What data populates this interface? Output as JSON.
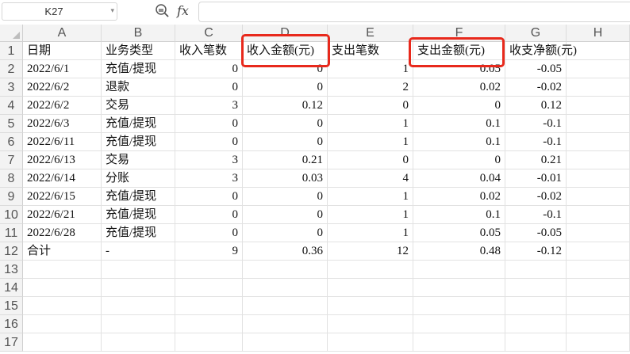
{
  "formula_bar": {
    "name_box": "K27",
    "fx_label": "fx",
    "formula": ""
  },
  "columns": [
    "A",
    "B",
    "C",
    "D",
    "E",
    "F",
    "G",
    "H"
  ],
  "row_numbers": [
    "1",
    "2",
    "3",
    "4",
    "5",
    "6",
    "7",
    "8",
    "9",
    "10",
    "11",
    "12",
    "13",
    "14",
    "15",
    "16",
    "17"
  ],
  "sheet": {
    "headers": [
      "日期",
      "业务类型",
      "收入笔数",
      "收入金额(元)",
      "支出笔数",
      "支出金额(元)",
      "收支净额(元)"
    ],
    "rows": [
      [
        "2022/6/1",
        "充值/提现",
        "0",
        "0",
        "1",
        "0.05",
        "-0.05"
      ],
      [
        "2022/6/2",
        "退款",
        "0",
        "0",
        "2",
        "0.02",
        "-0.02"
      ],
      [
        "2022/6/2",
        "交易",
        "3",
        "0.12",
        "0",
        "0",
        "0.12"
      ],
      [
        "2022/6/3",
        "充值/提现",
        "0",
        "0",
        "1",
        "0.1",
        "-0.1"
      ],
      [
        "2022/6/11",
        "充值/提现",
        "0",
        "0",
        "1",
        "0.1",
        "-0.1"
      ],
      [
        "2022/6/13",
        "交易",
        "3",
        "0.21",
        "0",
        "0",
        "0.21"
      ],
      [
        "2022/6/14",
        "分账",
        "3",
        "0.03",
        "4",
        "0.04",
        "-0.01"
      ],
      [
        "2022/6/15",
        "充值/提现",
        "0",
        "0",
        "1",
        "0.02",
        "-0.02"
      ],
      [
        "2022/6/21",
        "充值/提现",
        "0",
        "0",
        "1",
        "0.1",
        "-0.1"
      ],
      [
        "2022/6/28",
        "充值/提现",
        "0",
        "0",
        "1",
        "0.05",
        "-0.05"
      ]
    ],
    "total": [
      "合计",
      "-",
      "9",
      "0.36",
      "12",
      "0.48",
      "-0.12"
    ]
  },
  "highlight_color": "#e8291c",
  "icons": [
    "zoom-formula-icon",
    "dropdown-arrow-icon",
    "select-all-icon"
  ]
}
